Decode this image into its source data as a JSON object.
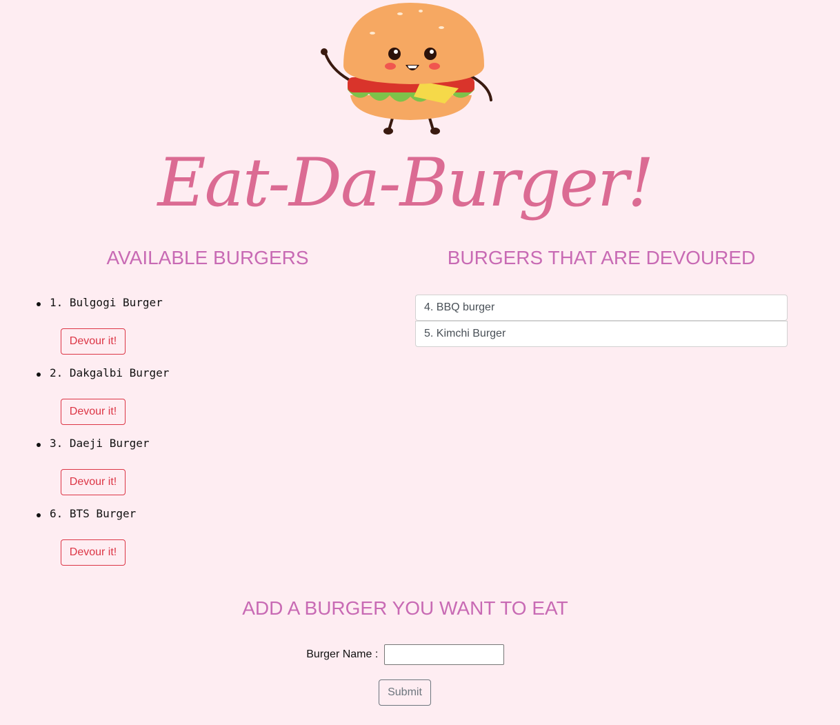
{
  "header": {
    "logo_icon": "smiling-burger-mascot",
    "title": "Eat-Da-Burger!"
  },
  "available": {
    "heading": "AVAILABLE BURGERS",
    "items": [
      {
        "label": "1. Bulgogi Burger",
        "button": "Devour it!"
      },
      {
        "label": "2. Dakgalbi Burger",
        "button": "Devour it!"
      },
      {
        "label": "3. Daeji Burger",
        "button": "Devour it!"
      },
      {
        "label": "6. BTS Burger",
        "button": "Devour it!"
      }
    ]
  },
  "devoured": {
    "heading": "BURGERS THAT ARE DEVOURED",
    "items": [
      {
        "label": "4. BBQ burger"
      },
      {
        "label": "5. Kimchi Burger"
      }
    ]
  },
  "add_form": {
    "heading": "ADD A BURGER YOU WANT TO EAT",
    "label": "Burger Name :",
    "input_value": "",
    "submit_label": "Submit"
  },
  "colors": {
    "background": "#feedf2",
    "title": "#db6b93",
    "heading": "#c86ab4",
    "danger": "#dc3545",
    "secondary": "#6c757d"
  }
}
